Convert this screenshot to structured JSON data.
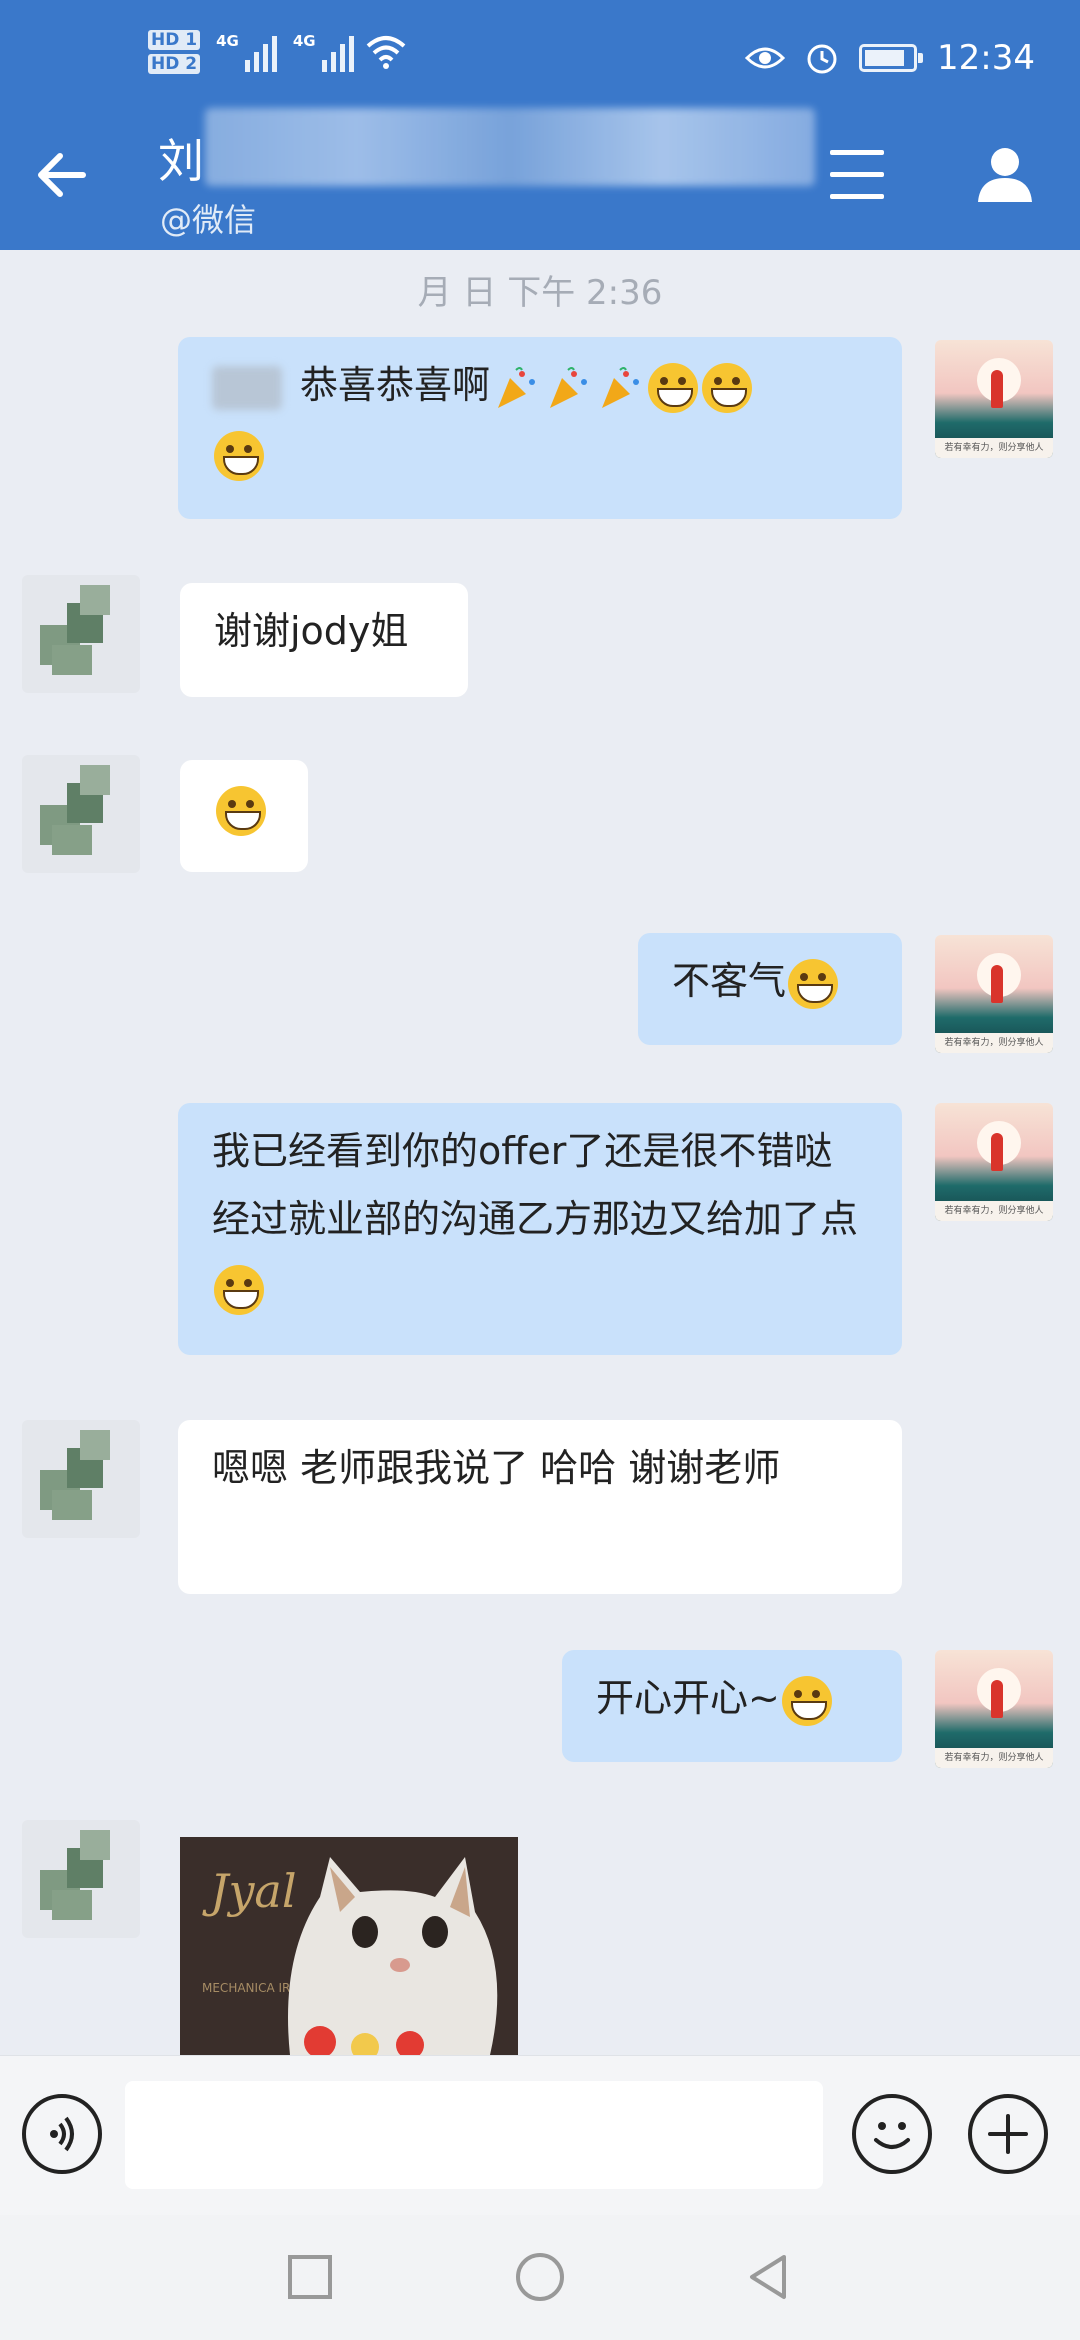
{
  "status_bar": {
    "hd_badge_1": "HD 1",
    "hd_badge_2": "HD 2",
    "network_1": "4G",
    "network_2": "4G",
    "time": "12:34",
    "battery_level": 0.85
  },
  "header": {
    "title": "刘",
    "subtitle": "@微信"
  },
  "chat": {
    "timestamp": "月 日 下午 2:36",
    "messages": [
      {
        "side": "out",
        "text": "恭喜恭喜啊"
      },
      {
        "side": "in",
        "text": "谢谢jody姐"
      },
      {
        "side": "in",
        "text": ""
      },
      {
        "side": "out",
        "text": "不客气"
      },
      {
        "side": "out",
        "text": "我已经看到你的offer了还是很不错哒经过就业部的沟通乙方那边又给加了点"
      },
      {
        "side": "in",
        "text": "嗯嗯 老师跟我说了 哈哈 谢谢老师"
      },
      {
        "side": "out",
        "text": "开心开心~"
      }
    ],
    "self_avatar_caption": "若有幸有力，则分享他人",
    "cat_image_text": "Jyal",
    "cat_image_subtext": "MECHANICA IRON-TOY"
  },
  "input": {
    "value": "",
    "placeholder": ""
  },
  "colors": {
    "header_bg": "#3a78ca",
    "bubble_out": "#c9e1fb",
    "bubble_in": "#ffffff",
    "chat_bg": "#eaedf3"
  },
  "icons": {
    "back": "arrow-left-icon",
    "menu": "menu-icon",
    "profile": "person-icon",
    "voice": "voice-icon",
    "emoji": "smiley-icon",
    "plus": "plus-icon"
  }
}
